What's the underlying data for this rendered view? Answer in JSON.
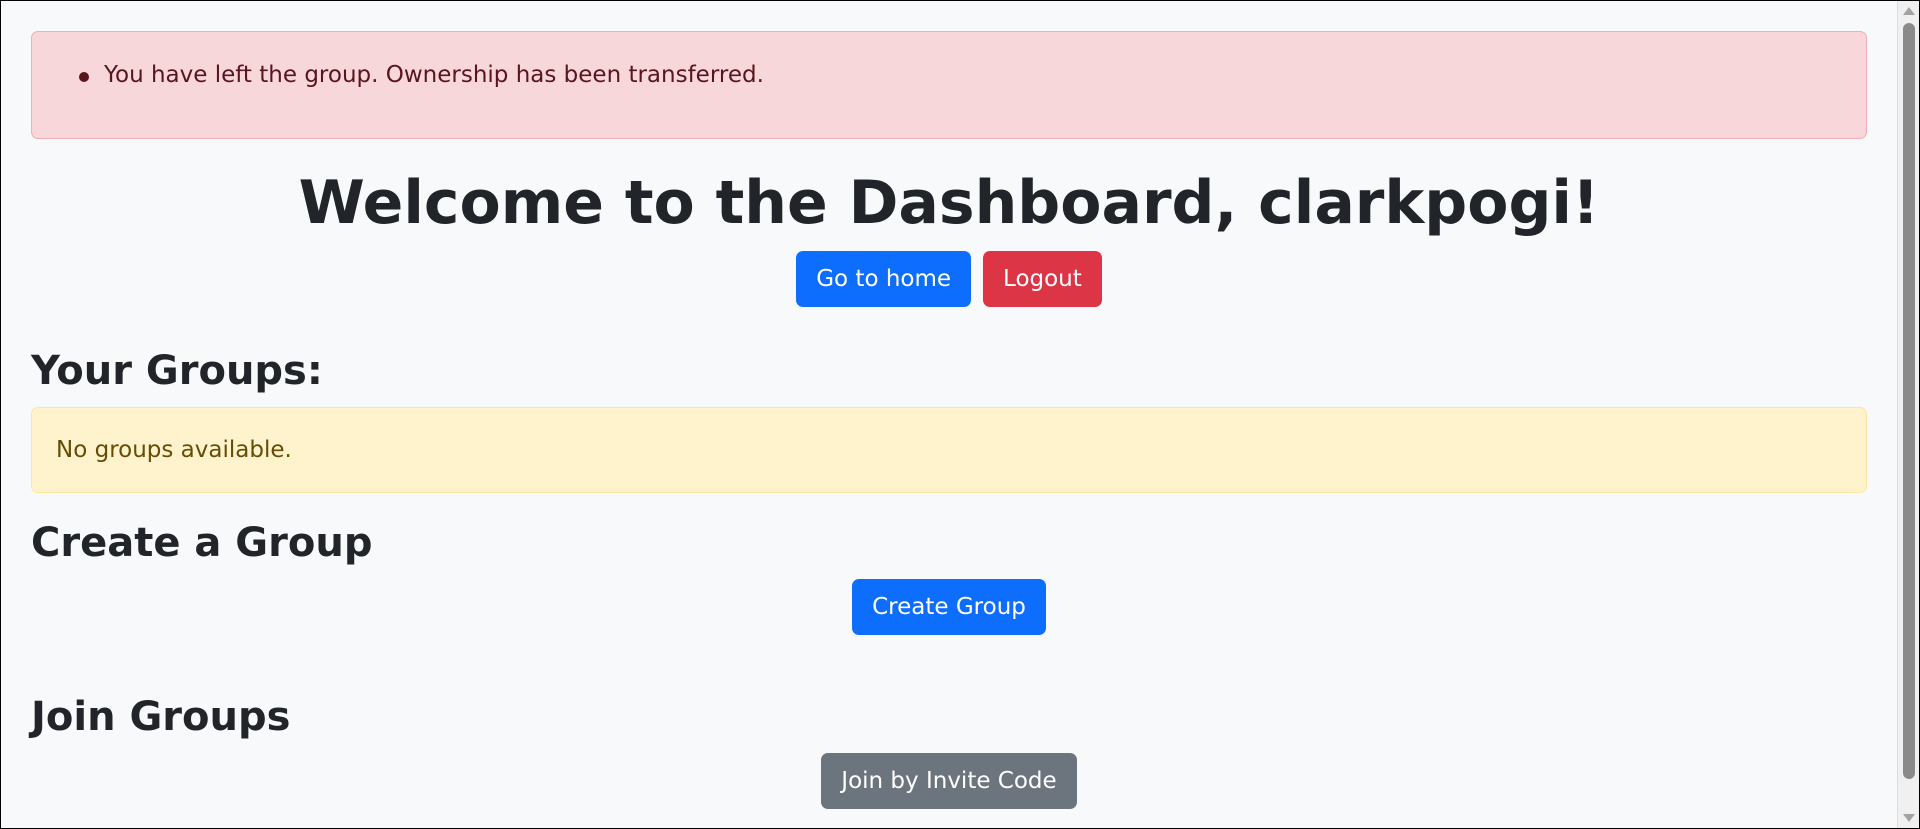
{
  "alert": {
    "message": "You have left the group. Ownership has been transferred."
  },
  "header": {
    "welcome": "Welcome to the Dashboard, clarkpogi!",
    "home_label": "Go to home",
    "logout_label": "Logout"
  },
  "groups": {
    "heading": "Your Groups:",
    "empty_message": "No groups available."
  },
  "create": {
    "heading": "Create a Group",
    "button_label": "Create Group"
  },
  "join": {
    "heading": "Join Groups",
    "button_label": "Join by Invite Code"
  },
  "colors": {
    "primary": "#0d6efd",
    "danger": "#dc3545",
    "secondary": "#6c757d",
    "alert_danger_bg": "#f8d7da",
    "alert_warning_bg": "#fff3cd"
  }
}
